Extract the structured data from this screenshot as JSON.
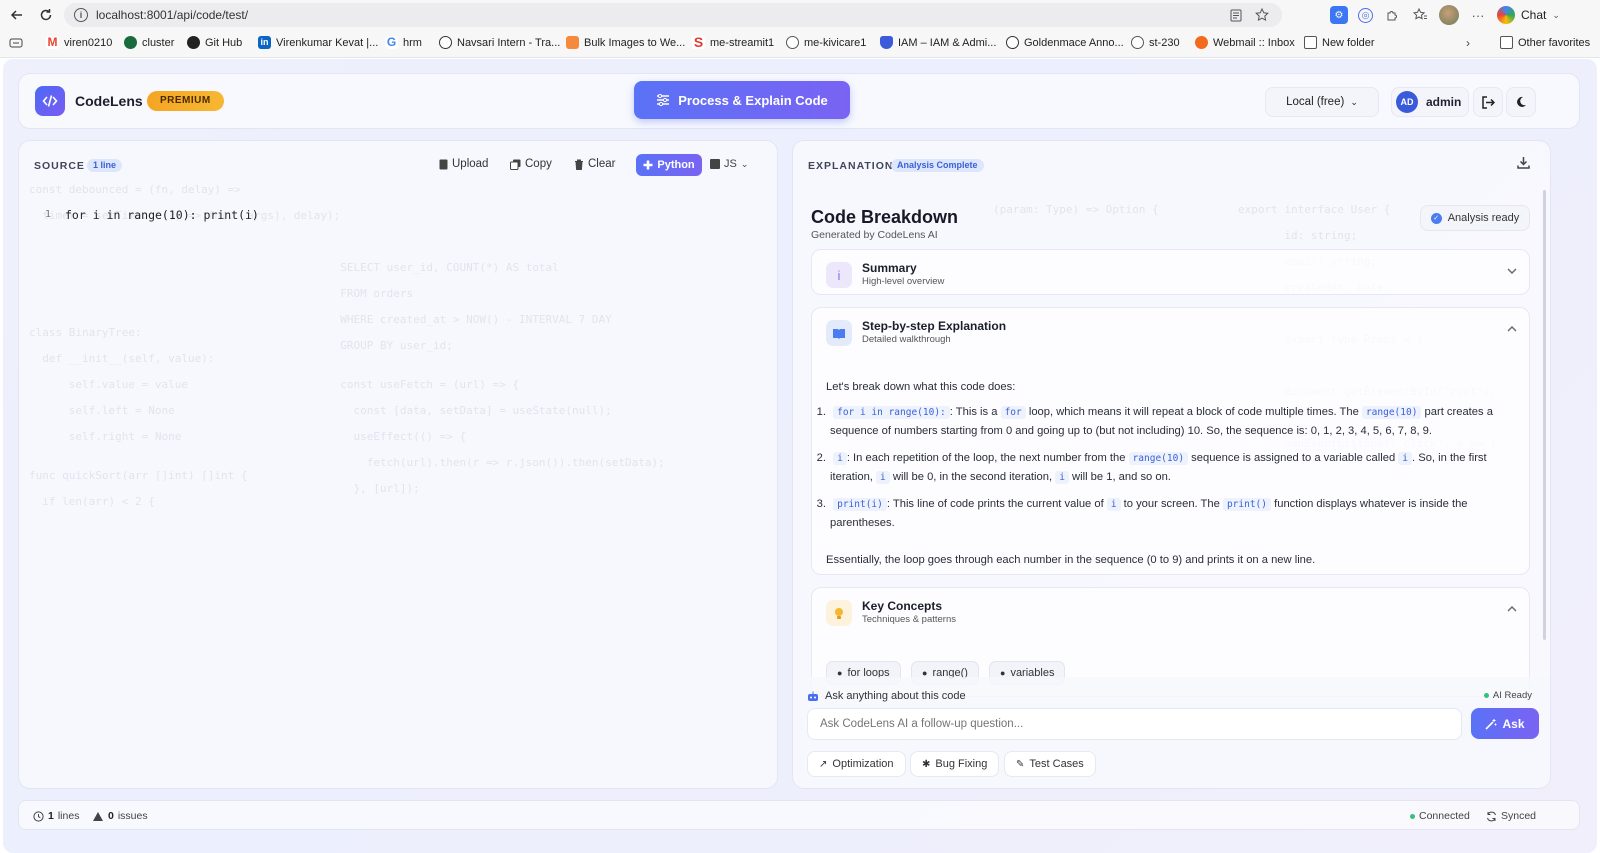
{
  "browser": {
    "url": "localhost:8001/api/code/test/",
    "chat_label": "Chat",
    "bookmarks": [
      {
        "label": "viren0210",
        "icon": "gmail-icon",
        "color": "#ea4335"
      },
      {
        "label": "cluster",
        "icon": "mongodb-icon",
        "color": "#1a6b3c"
      },
      {
        "label": "Git Hub",
        "icon": "github-icon",
        "color": "#222222"
      },
      {
        "label": "Virenkumar Kevat |...",
        "icon": "linkedin-icon",
        "color": "#0a66c2"
      },
      {
        "label": "hrm",
        "icon": "google-icon",
        "color": "#4285f4"
      },
      {
        "label": "Navsari Intern - Tra...",
        "icon": "clock-icon",
        "color": "#333333"
      },
      {
        "label": "Bulk Images to We...",
        "icon": "image-icon",
        "color": "#f58a3c"
      },
      {
        "label": "me-streamit1",
        "icon": "streamit-icon",
        "color": "#e53935"
      },
      {
        "label": "me-kivicare1",
        "icon": "globe-icon",
        "color": "#555555"
      },
      {
        "label": "IAM – IAM & Admi...",
        "icon": "shield-icon",
        "color": "#3b5bdb"
      },
      {
        "label": "Goldenmace Anno...",
        "icon": "clock-icon",
        "color": "#333333"
      },
      {
        "label": "st-230",
        "icon": "globe-icon",
        "color": "#555555"
      },
      {
        "label": "Webmail :: Inbox",
        "icon": "cpanel-icon",
        "color": "#f26b1d"
      },
      {
        "label": "New folder",
        "icon": "folder-icon",
        "color": "#555555"
      }
    ],
    "other_favorites": "Other favorites"
  },
  "header": {
    "brand": "CodeLens",
    "premium": "PREMIUM",
    "process_button": "Process & Explain Code",
    "model": "Local (free)",
    "user_initials": "AD",
    "user_name": "admin"
  },
  "source": {
    "label": "SOURCE",
    "line_badge": "1 line",
    "upload": "Upload",
    "copy": "Copy",
    "clear": "Clear",
    "lang_active": "Python",
    "lang_other": "JS",
    "line_number": "1",
    "code": "for i in range(10): print(i)"
  },
  "explanation": {
    "label": "EXPLANATION",
    "status_badge": "Analysis Complete",
    "title": "Code Breakdown",
    "subtitle": "Generated by CodeLens AI",
    "ready": "Analysis ready",
    "summary": {
      "title": "Summary",
      "subtitle": "High-level overview"
    },
    "steps_card": {
      "title": "Step-by-step Explanation",
      "subtitle": "Detailed walkthrough"
    },
    "intro": "Let's break down what this code does:",
    "steps": [
      {
        "num": "1.",
        "code": "for i in range(10):",
        "t1": ": This is a ",
        "c2": "for",
        "t2": " loop, which means it will repeat a block of code multiple times. The ",
        "c3": "range(10)",
        "t3": " part creates a sequence of numbers starting from 0 and going up to (but not including) 10. So, the sequence is: 0, 1, 2, 3, 4, 5, 6, 7, 8, 9."
      },
      {
        "num": "2.",
        "code": "i",
        "t1": ": In each repetition of the loop, the next number from the ",
        "c2": "range(10)",
        "t2": " sequence is assigned to a variable called ",
        "c3": "i",
        "t3": ". So, in the first iteration, ",
        "c4": "i",
        "t4": " will be 0, in the second iteration, ",
        "c5": "i",
        "t5": " will be 1, and so on."
      },
      {
        "num": "3.",
        "code": "print(i)",
        "t1": ": This line of code prints the current value of ",
        "c2": "i",
        "t2": " to your screen. The ",
        "c3": "print()",
        "t3": " function displays whatever is inside the parentheses."
      }
    ],
    "outro": "Essentially, the loop goes through each number in the sequence (0 to 9) and prints it on a new line.",
    "concepts": {
      "title": "Key Concepts",
      "subtitle": "Techniques & patterns",
      "tags": [
        "for loops",
        "range()",
        "variables"
      ]
    },
    "ask_label": "Ask anything about this code",
    "ai_ready": "AI Ready",
    "ask_placeholder": "Ask CodeLens AI a follow-up question...",
    "ask_button": "Ask",
    "chips": [
      "Optimization",
      "Bug Fixing",
      "Test Cases"
    ]
  },
  "footer": {
    "lines_count": "1",
    "lines_label": "lines",
    "issues_count": "0",
    "issues_label": "issues",
    "connected": "Connected",
    "synced": "Synced"
  }
}
